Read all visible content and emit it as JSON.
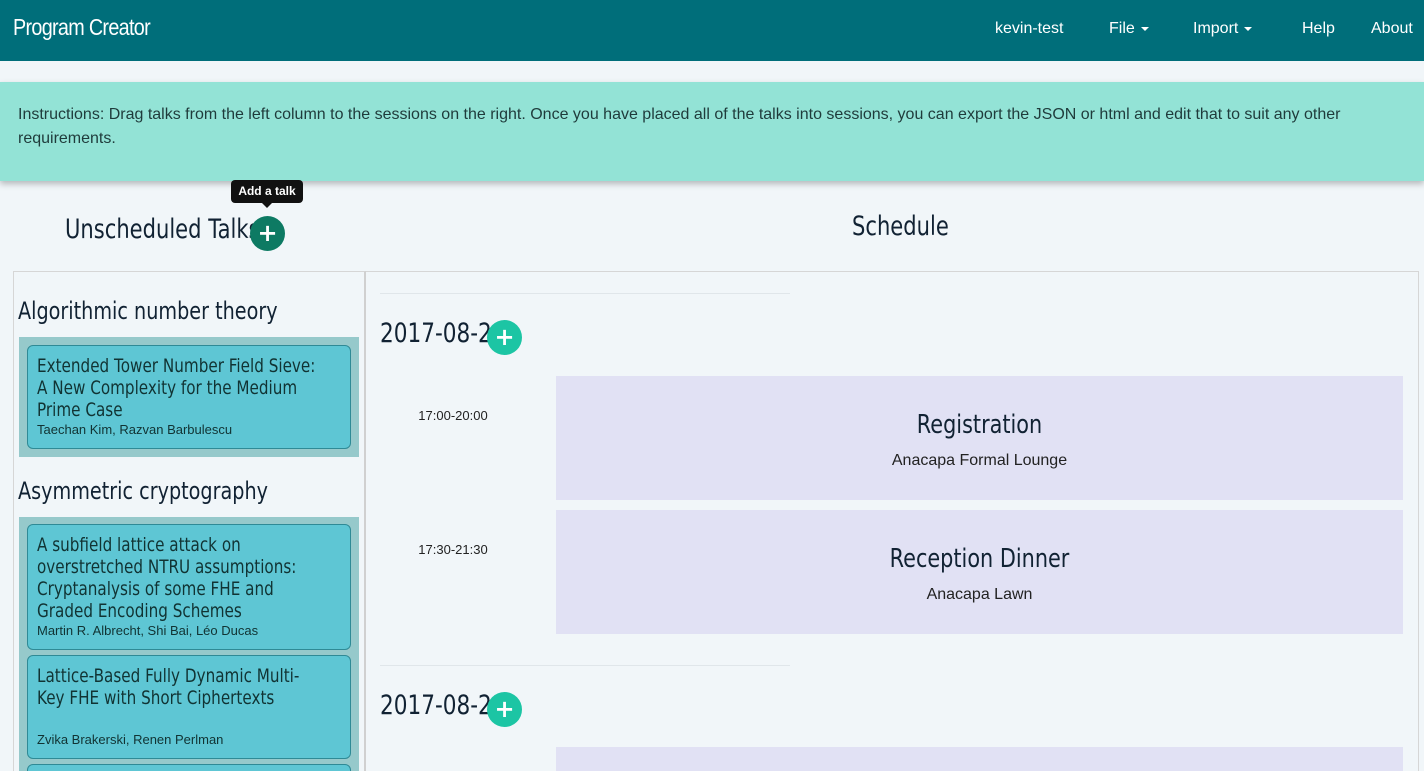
{
  "navbar": {
    "brand": "Program Creator",
    "user": "kevin-test",
    "file": "File",
    "import": "Import",
    "help": "Help",
    "about": "About"
  },
  "instructions": "Instructions: Drag talks from the left column to the sessions on the right. Once you have placed all of the talks into sessions, you can export the JSON or html and edit that to suit any other requirements.",
  "tooltip": "Add a talk",
  "unscheduled": {
    "heading": "Unscheduled Talks",
    "add_icon": "plus-icon",
    "categories": [
      {
        "name": "Algorithmic number theory",
        "talks": [
          {
            "title": "Extended Tower Number Field Sieve: A New Complexity for the Medium Prime Case",
            "authors": "Taechan Kim, Razvan Barbulescu"
          }
        ]
      },
      {
        "name": "Asymmetric cryptography",
        "talks": [
          {
            "title": "A subfield lattice attack on overstretched NTRU assumptions: Cryptanalysis of some FHE and Graded Encoding Schemes",
            "authors": "Martin R. Albrecht, Shi Bai, Léo Ducas"
          },
          {
            "title": "Lattice-Based Fully Dynamic Multi-Key FHE with Short Ciphertexts",
            "authors": "Zvika Brakerski, Renen Perlman"
          }
        ]
      }
    ]
  },
  "schedule": {
    "heading": "Schedule",
    "days": [
      {
        "date": "2017-08-20",
        "sessions": [
          {
            "time": "17:00-20:00",
            "title": "Registration",
            "location": "Anacapa Formal Lounge"
          },
          {
            "time": "17:30-21:30",
            "title": "Reception Dinner",
            "location": "Anacapa Lawn"
          }
        ]
      },
      {
        "date": "2017-08-21",
        "sessions": []
      }
    ]
  },
  "colors": {
    "navbar": "#006e7a",
    "instructions": "#93e3d6",
    "talk_card": "#5ec6d4",
    "category_block": "#96c9cb",
    "session": "#e1e1f4",
    "add_button_dark": "#0d7a63",
    "add_button_light": "#1cc5a4"
  }
}
